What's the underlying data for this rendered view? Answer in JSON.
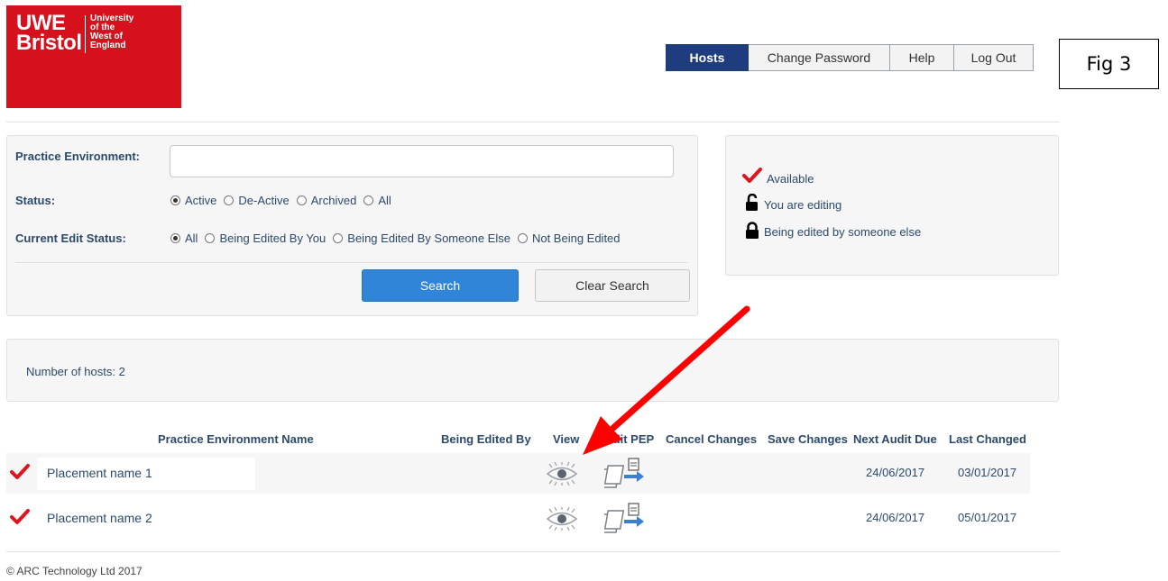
{
  "logo": {
    "line1": "UWE",
    "line2": "Bristol",
    "small1": "University",
    "small2": "of the",
    "small3": "West of",
    "small4": "England"
  },
  "nav": [
    {
      "label": "Hosts",
      "active": true
    },
    {
      "label": "Change Password",
      "active": false
    },
    {
      "label": "Help",
      "active": false
    },
    {
      "label": "Log Out",
      "active": false
    }
  ],
  "figure_label": "Fig 3",
  "search": {
    "practice_env_label": "Practice Environment:",
    "practice_env_value": "",
    "status_label": "Status:",
    "status_options": [
      "Active",
      "De-Active",
      "Archived",
      "All"
    ],
    "status_selected": "Active",
    "edit_status_label": "Current Edit Status:",
    "edit_status_options": [
      "All",
      "Being Edited By You",
      "Being Edited By Someone Else",
      "Not Being Edited"
    ],
    "edit_status_selected": "All",
    "search_button": "Search",
    "clear_button": "Clear Search"
  },
  "legend": {
    "available": "Available",
    "you_editing": "You are editing",
    "someone_else": "Being edited by someone else"
  },
  "summary": {
    "hosts_count_text": "Number of hosts: 2"
  },
  "table": {
    "headers": {
      "name": "Practice Environment Name",
      "edited_by": "Being Edited By",
      "view": "View",
      "edit_pep": "Edit PEP",
      "cancel": "Cancel Changes",
      "save": "Save Changes",
      "next_audit": "Next Audit Due",
      "last_changed": "Last Changed"
    },
    "rows": [
      {
        "name": "Placement name 1",
        "next_audit": "24/06/2017",
        "last_changed": "03/01/2017"
      },
      {
        "name": "Placement name 2",
        "next_audit": "24/06/2017",
        "last_changed": "05/01/2017"
      }
    ]
  },
  "footer": "© ARC Technology Ltd 2017",
  "colors": {
    "brand_red": "#d7101e",
    "nav_active": "#1f3d7e",
    "search_button": "#2f86d8",
    "annotation_arrow": "#ff0000"
  }
}
